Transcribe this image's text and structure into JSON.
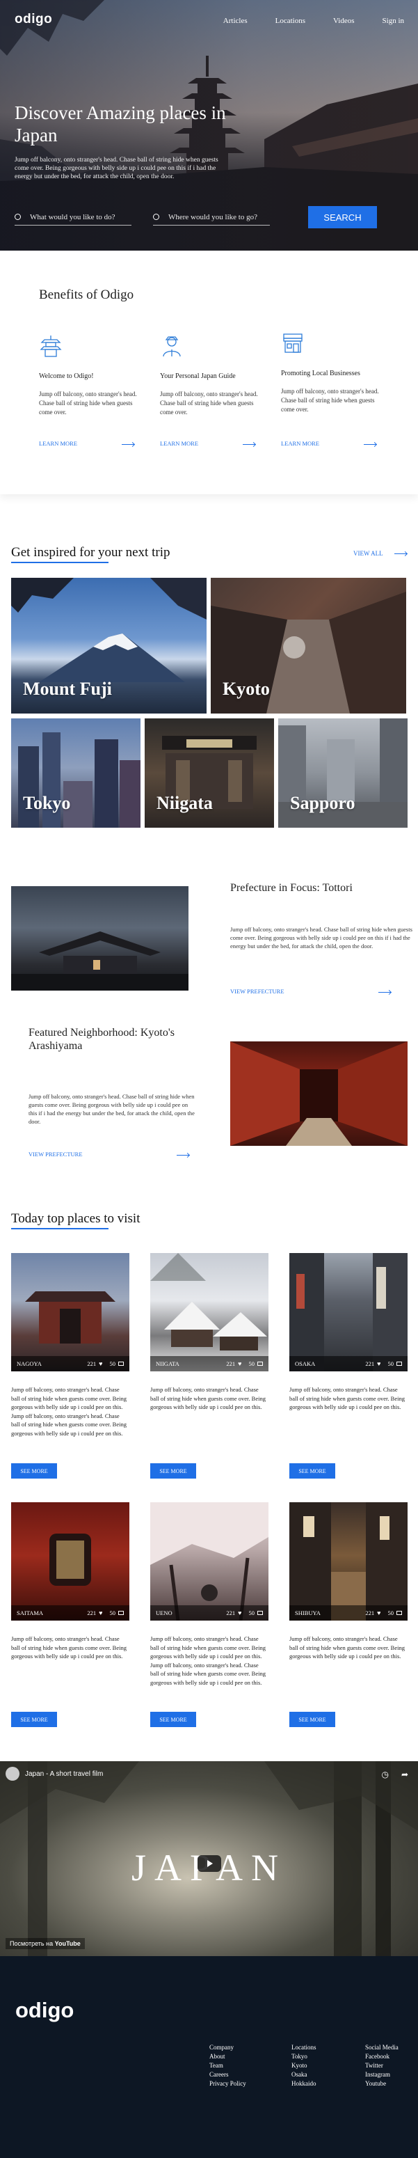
{
  "header": {
    "logo": "odigo",
    "nav": [
      "Articles",
      "Locations",
      "Videos",
      "Sign in"
    ]
  },
  "hero": {
    "title": "Discover Amazing places in Japan",
    "subtitle": "Jump off balcony, onto stranger's head. Chase ball of string hide when guests come over. Being gorgeous with belly side up i could pee on this if i had the energy but under the bed, for attack the child, open the door.",
    "search_what_placeholder": "What would you like to do?",
    "search_where_placeholder": "Where would you like to go?",
    "search_button": "SEARCH"
  },
  "benefits": {
    "title": "Benefits of Odigo",
    "cards": [
      {
        "title": "Welcome to Odigo!",
        "text": "Jump off balcony, onto stranger's head. Chase ball of string hide when guests come over.",
        "link": "LEARN MORE",
        "icon": "pagoda-icon"
      },
      {
        "title": "Your Personal Japan Guide",
        "text": "Jump off balcony, onto stranger's head. Chase ball of string hide when guests come over.",
        "link": "LEARN MORE",
        "icon": "guide-person-icon"
      },
      {
        "title": "Promoting Local Businesses",
        "text": "Jump off balcony, onto stranger's head. Chase ball of string hide when guests come over.",
        "link": "LEARN MORE",
        "icon": "shop-icon"
      }
    ]
  },
  "inspired": {
    "title": "Get inspired for your next trip",
    "view_all": "VIEW ALL",
    "places": [
      "Mount Fuji",
      "Kyoto",
      "Tokyo",
      "Niigata",
      "Sapporo"
    ]
  },
  "features": [
    {
      "title": "Prefecture in Focus: Tottori",
      "text": "Jump off balcony, onto stranger's head. Chase ball of string hide when guests come over. Being gorgeous with belly side up i could pee on this if i had the energy but under the bed, for attack the child, open the door.",
      "link": "VIEW PREFECTURE"
    },
    {
      "title": "Featured Neighborhood: Kyoto's Arashiyama",
      "text": "Jump off balcony, onto stranger's head. Chase ball of string hide when guests come over. Being gorgeous with belly side up i could pee on this if i had the energy but under the bed, for attack the child, open the door.",
      "link": "VIEW PREFECTURE"
    }
  ],
  "today": {
    "title": "Today top places to visit",
    "cards": [
      {
        "name": "NAGOYA",
        "likes": "221",
        "comments": "50",
        "text": "Jump off balcony, onto stranger's head. Chase ball of string hide when guests come over. Being gorgeous with belly side up i could pee on this. Jump off balcony, onto stranger's head. Chase ball of string hide when guests come over. Being gorgeous with belly side up i could pee on this.",
        "button": "SEE MORE"
      },
      {
        "name": "NIIGATA",
        "likes": "221",
        "comments": "50",
        "text": "Jump off balcony, onto stranger's head. Chase ball of string hide when guests come over. Being gorgeous with belly side up i could pee on this.",
        "button": "SEE MORE"
      },
      {
        "name": "OSAKA",
        "likes": "221",
        "comments": "50",
        "text": "Jump off balcony, onto stranger's head. Chase ball of string hide when guests come over. Being gorgeous with belly side up i could pee on this.",
        "button": "SEE MORE"
      },
      {
        "name": "SAITAMA",
        "likes": "221",
        "comments": "50",
        "text": "Jump off balcony, onto stranger's head. Chase ball of string hide when guests come over. Being gorgeous with belly side up i could pee on this.",
        "button": "SEE MORE"
      },
      {
        "name": "UENO",
        "likes": "221",
        "comments": "50",
        "text": "Jump off balcony, onto stranger's head. Chase ball of string hide when guests come over. Being gorgeous with belly side up i could pee on this. Jump off balcony, onto stranger's head. Chase ball of string hide when guests come over. Being gorgeous with belly side up i could pee on this.",
        "button": "SEE MORE"
      },
      {
        "name": "SHIBUYA",
        "likes": "221",
        "comments": "50",
        "text": "Jump off balcony, onto stranger's head. Chase ball of string hide when guests come over. Being gorgeous with belly side up i could pee on this.",
        "button": "SEE MORE"
      }
    ]
  },
  "video": {
    "channel_title": "Japan - A short travel film",
    "big_title": "JAPAN",
    "watch_on": "Посмотреть на",
    "platform": "YouTube"
  },
  "footer": {
    "logo": "odigo",
    "columns": [
      {
        "head": "Company",
        "items": [
          "About",
          "Team",
          "Careers",
          "Privacy Policy"
        ]
      },
      {
        "head": "Locations",
        "items": [
          "Tokyo",
          "Kyoto",
          "Osaka",
          "Hokkaido"
        ]
      },
      {
        "head": "Social Media",
        "items": [
          "Facebook",
          "Twitter",
          "Instagram",
          "Youtube"
        ]
      }
    ]
  },
  "colors": {
    "accent": "#1f6fe6",
    "footer_bg": "#0d1724"
  }
}
